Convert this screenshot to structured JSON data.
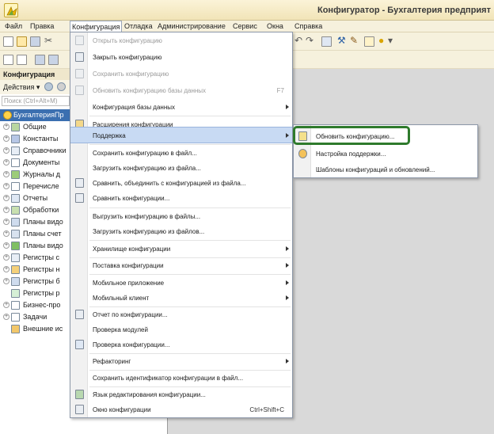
{
  "window": {
    "title": "Конфигуратор - Бухгалтерия предприят",
    "logo_icon": "1c-logo-icon"
  },
  "menubar": {
    "items": [
      {
        "label": "Файл"
      },
      {
        "label": "Правка"
      },
      {
        "label": "Конфигурация",
        "active": true
      },
      {
        "label": "Отладка"
      },
      {
        "label": "Администрирование"
      },
      {
        "label": "Сервис"
      },
      {
        "label": "Окна"
      },
      {
        "label": "Справка"
      }
    ]
  },
  "panel": {
    "header": "Конфигурация",
    "actions_label": "Действия ▾",
    "search_placeholder": "Поиск (Ctrl+Alt+M)",
    "tree": [
      {
        "label": "БухгалтерияПр",
        "root": true,
        "icon": "configuration-icon"
      },
      {
        "label": "Общие",
        "icon": "common-icon"
      },
      {
        "label": "Константы",
        "icon": "constants-icon"
      },
      {
        "label": "Справочники",
        "icon": "catalogs-icon"
      },
      {
        "label": "Документы",
        "icon": "documents-icon"
      },
      {
        "label": "Журналы д",
        "icon": "journals-icon"
      },
      {
        "label": "Перечисле",
        "icon": "enums-icon"
      },
      {
        "label": "Отчеты",
        "icon": "reports-icon"
      },
      {
        "label": "Обработки",
        "icon": "processing-icon"
      },
      {
        "label": "Планы видо",
        "icon": "chart-types-icon"
      },
      {
        "label": "Планы счет",
        "icon": "chart-accounts-icon"
      },
      {
        "label": "Планы видо",
        "icon": "calc-types-icon"
      },
      {
        "label": "Регистры с",
        "icon": "info-registers-icon"
      },
      {
        "label": "Регистры н",
        "icon": "accum-registers-icon"
      },
      {
        "label": "Регистры б",
        "icon": "acc-registers-icon"
      },
      {
        "label": "Регистры р",
        "icon": "calc-registers-icon"
      },
      {
        "label": "Бизнес-про",
        "icon": "business-process-icon"
      },
      {
        "label": "Задачи",
        "icon": "tasks-icon"
      },
      {
        "label": "Внешние ис",
        "icon": "external-sources-icon"
      }
    ]
  },
  "dropdown": {
    "items": [
      {
        "label": "Открыть конфигурацию",
        "disabled": true,
        "icon": "open-config-icon"
      },
      {
        "label": "Закрыть конфигурацию",
        "icon": "close-config-icon"
      },
      {
        "label": "Сохранить конфигурацию",
        "disabled": true,
        "icon": "save-config-icon"
      },
      {
        "label": "Обновить конфигурацию базы данных",
        "disabled": true,
        "shortcut": "F7",
        "icon": "update-db-icon"
      },
      {
        "label": "Конфигурация базы данных",
        "submenu": true
      },
      {
        "sep": true
      },
      {
        "label": "Расширения конфигурации",
        "icon": "extensions-icon"
      },
      {
        "sep": true
      },
      {
        "label": "Поддержка",
        "submenu": true,
        "highlighted": true
      },
      {
        "sep": true
      },
      {
        "label": "Сохранить конфигурацию в файл..."
      },
      {
        "label": "Загрузить конфигурацию из файла..."
      },
      {
        "label": "Сравнить, объединить с конфигурацией из файла...",
        "icon": "compare-merge-icon"
      },
      {
        "label": "Сравнить конфигурации...",
        "icon": "compare-icon"
      },
      {
        "sep": true
      },
      {
        "label": "Выгрузить конфигурацию в файлы..."
      },
      {
        "label": "Загрузить конфигурацию из файлов..."
      },
      {
        "sep": true
      },
      {
        "label": "Хранилище конфигурации",
        "submenu": true
      },
      {
        "sep": true
      },
      {
        "label": "Поставка конфигурации",
        "submenu": true
      },
      {
        "sep": true
      },
      {
        "label": "Мобильное приложение",
        "submenu": true
      },
      {
        "label": "Мобильный клиент",
        "submenu": true
      },
      {
        "sep": true
      },
      {
        "label": "Отчет по конфигурации...",
        "icon": "report-config-icon"
      },
      {
        "label": "Проверка модулей"
      },
      {
        "label": "Проверка конфигурации...",
        "icon": "check-config-icon"
      },
      {
        "sep": true
      },
      {
        "label": "Рефакторинг",
        "submenu": true
      },
      {
        "sep": true
      },
      {
        "label": "Сохранить идентификатор конфигурации в файл..."
      },
      {
        "sep": true
      },
      {
        "label": "Язык редактирования конфигурации...",
        "icon": "edit-language-icon"
      },
      {
        "label": "Окно конфигурации",
        "shortcut": "Ctrl+Shift+C",
        "icon": "config-window-icon"
      }
    ]
  },
  "submenu": {
    "items": [
      {
        "label": "Обновить конфигурацию...",
        "icon": "update-config-icon",
        "focused": true
      },
      {
        "label": "Настройка поддержки...",
        "icon": "support-settings-icon"
      },
      {
        "label": "Шаблоны конфигураций и обновлений..."
      }
    ]
  },
  "colors": {
    "focus_ring": "#2e7a2c",
    "highlight": "#c8daf3",
    "tree_selected": "#3b6fb0"
  }
}
